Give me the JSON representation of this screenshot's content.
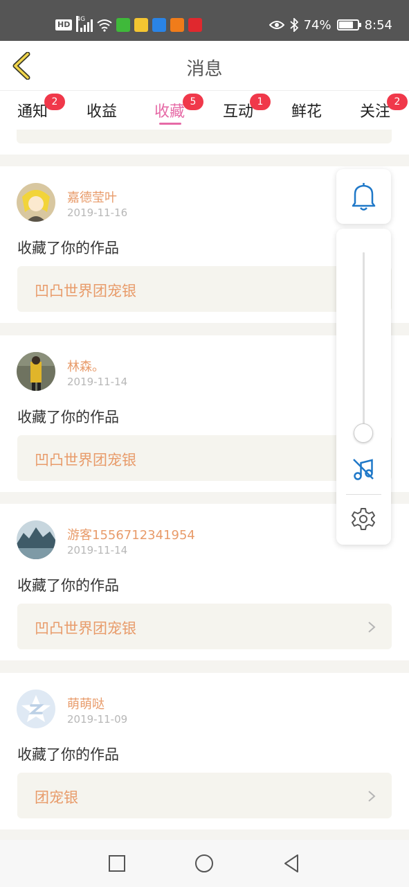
{
  "status_bar": {
    "hd": "HD",
    "network": "4G",
    "battery_percent": "74%",
    "time": "8:54",
    "icons": [
      "hd-icon",
      "signal-icon",
      "wifi-icon",
      "iqiyi-app-icon",
      "weather-app-icon",
      "browser-app-icon",
      "taobao-app-icon",
      "game-app-icon",
      "eye-icon",
      "bluetooth-icon",
      "battery-icon"
    ]
  },
  "header": {
    "title": "消息",
    "back_icon": "chevron-left-icon"
  },
  "tabs": [
    {
      "label": "通知",
      "badge": "2",
      "active": false
    },
    {
      "label": "收益",
      "badge": "",
      "active": false
    },
    {
      "label": "收藏",
      "badge": "5",
      "active": true
    },
    {
      "label": "互动",
      "badge": "1",
      "active": false
    },
    {
      "label": "鲜花",
      "badge": "",
      "active": false
    },
    {
      "label": "关注",
      "badge": "2",
      "active": false
    }
  ],
  "colors": {
    "accent": "#e66aa6",
    "badge": "#f0384a",
    "username": "#e89b6a",
    "widget_blue": "#1f78c8",
    "status_bar": "#555555"
  },
  "messages": [
    {
      "user": "嘉德莹叶",
      "date": "2019-11-16",
      "action": "收藏了你的作品",
      "work": "凹凸世界团宠银"
    },
    {
      "user": "林森。",
      "date": "2019-11-14",
      "action": "收藏了你的作品",
      "work": "凹凸世界团宠银"
    },
    {
      "user": "游客1556712341954",
      "date": "2019-11-14",
      "action": "收藏了你的作品",
      "work": "凹凸世界团宠银"
    },
    {
      "user": "萌萌哒",
      "date": "2019-11-09",
      "action": "收藏了你的作品",
      "work": "团宠银"
    }
  ],
  "floating_widget": {
    "icons": [
      "bell-icon",
      "music-off-icon",
      "gear-icon"
    ],
    "slider_level": 0.05
  },
  "nav_bar": {
    "icons": [
      "recent-apps-icon",
      "home-icon",
      "back-icon"
    ]
  }
}
